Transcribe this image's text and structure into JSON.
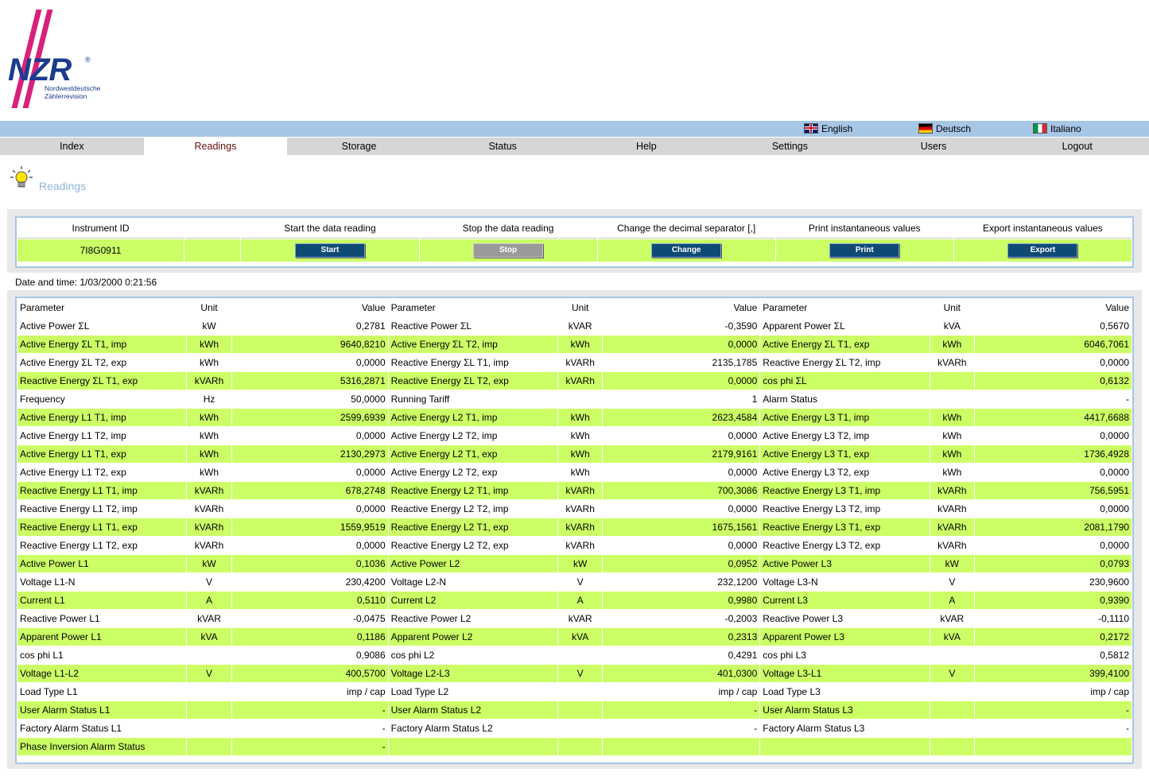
{
  "logo": {
    "brand": "NZR",
    "registered": "®",
    "subtitle_line1": "Nordwestdeutsche",
    "subtitle_line2": "Zählerrevision"
  },
  "languages": [
    {
      "label": "English",
      "icon": "flag-uk-icon"
    },
    {
      "label": "Deutsch",
      "icon": "flag-de-icon"
    },
    {
      "label": "Italiano",
      "icon": "flag-it-icon"
    }
  ],
  "nav": [
    {
      "label": "Index"
    },
    {
      "label": "Readings",
      "active": true
    },
    {
      "label": "Storage"
    },
    {
      "label": "Status"
    },
    {
      "label": "Help"
    },
    {
      "label": "Settings"
    },
    {
      "label": "Users"
    },
    {
      "label": "Logout"
    }
  ],
  "page": {
    "title": "Readings",
    "icon": "lightbulb-icon"
  },
  "controls": {
    "headers": [
      "Instrument ID",
      "",
      "Start the data reading",
      "Stop the data reading",
      "Change the decimal separator [,]",
      "Print instantaneous values",
      "Export instantaneous values"
    ],
    "instrument_id": "7I8G0911",
    "buttons": [
      {
        "label": "Start",
        "enabled": true
      },
      {
        "label": "Stop",
        "enabled": false
      },
      {
        "label": "Change",
        "enabled": true
      },
      {
        "label": "Print",
        "enabled": true
      },
      {
        "label": "Export",
        "enabled": true
      }
    ]
  },
  "datetime": "Date and time: 1/03/2000 0:21:56",
  "readings": {
    "headers": [
      "Parameter",
      "Unit",
      "Value"
    ],
    "rows": [
      [
        [
          "Active Power ΣL",
          "kW",
          "0,2781"
        ],
        [
          "Reactive Power ΣL",
          "kVAR",
          "-0,3590"
        ],
        [
          "Apparent Power ΣL",
          "kVA",
          "0,5670"
        ]
      ],
      [
        [
          "Active Energy ΣL T1, imp",
          "kWh",
          "9640,8210"
        ],
        [
          "Active Energy ΣL T2, imp",
          "kWh",
          "0,0000"
        ],
        [
          "Active Energy ΣL T1, exp",
          "kWh",
          "6046,7061"
        ]
      ],
      [
        [
          "Active Energy ΣL T2, exp",
          "kWh",
          "0,0000"
        ],
        [
          "Reactive Energy ΣL T1, imp",
          "kVARh",
          "2135,1785"
        ],
        [
          "Reactive Energy ΣL T2, imp",
          "kVARh",
          "0,0000"
        ]
      ],
      [
        [
          "Reactive Energy ΣL T1, exp",
          "kVARh",
          "5316,2871"
        ],
        [
          "Reactive Energy ΣL T2, exp",
          "kVARh",
          "0,0000"
        ],
        [
          "cos phi ΣL",
          "",
          "0,6132"
        ]
      ],
      [
        [
          "Frequency",
          "Hz",
          "50,0000"
        ],
        [
          "Running Tariff",
          "",
          "1"
        ],
        [
          "Alarm Status",
          "",
          "-"
        ]
      ],
      [
        [
          "Active Energy L1 T1, imp",
          "kWh",
          "2599,6939"
        ],
        [
          "Active Energy L2 T1, imp",
          "kWh",
          "2623,4584"
        ],
        [
          "Active Energy L3 T1, imp",
          "kWh",
          "4417,6688"
        ]
      ],
      [
        [
          "Active Energy L1 T2, imp",
          "kWh",
          "0,0000"
        ],
        [
          "Active Energy L2 T2, imp",
          "kWh",
          "0,0000"
        ],
        [
          "Active Energy L3 T2, imp",
          "kWh",
          "0,0000"
        ]
      ],
      [
        [
          "Active Energy L1 T1, exp",
          "kWh",
          "2130,2973"
        ],
        [
          "Active Energy L2 T1, exp",
          "kWh",
          "2179,9161"
        ],
        [
          "Active Energy L3 T1, exp",
          "kWh",
          "1736,4928"
        ]
      ],
      [
        [
          "Active Energy L1 T2, exp",
          "kWh",
          "0,0000"
        ],
        [
          "Active Energy L2 T2, exp",
          "kWh",
          "0,0000"
        ],
        [
          "Active Energy L3 T2, exp",
          "kWh",
          "0,0000"
        ]
      ],
      [
        [
          "Reactive Energy L1 T1, imp",
          "kVARh",
          "678,2748"
        ],
        [
          "Reactive Energy L2 T1, imp",
          "kVARh",
          "700,3086"
        ],
        [
          "Reactive Energy L3 T1, imp",
          "kVARh",
          "756,5951"
        ]
      ],
      [
        [
          "Reactive Energy L1 T2, imp",
          "kVARh",
          "0,0000"
        ],
        [
          "Reactive Energy L2 T2, imp",
          "kVARh",
          "0,0000"
        ],
        [
          "Reactive Energy L3 T2, imp",
          "kVARh",
          "0,0000"
        ]
      ],
      [
        [
          "Reactive Energy L1 T1, exp",
          "kVARh",
          "1559,9519"
        ],
        [
          "Reactive Energy L2 T1, exp",
          "kVARh",
          "1675,1561"
        ],
        [
          "Reactive Energy L3 T1, exp",
          "kVARh",
          "2081,1790"
        ]
      ],
      [
        [
          "Reactive Energy L1 T2, exp",
          "kVARh",
          "0,0000"
        ],
        [
          "Reactive Energy L2 T2, exp",
          "kVARh",
          "0,0000"
        ],
        [
          "Reactive Energy L3 T2, exp",
          "kVARh",
          "0,0000"
        ]
      ],
      [
        [
          "Active Power L1",
          "kW",
          "0,1036"
        ],
        [
          "Active Power L2",
          "kW",
          "0,0952"
        ],
        [
          "Active Power L3",
          "kW",
          "0,0793"
        ]
      ],
      [
        [
          "Voltage L1-N",
          "V",
          "230,4200"
        ],
        [
          "Voltage L2-N",
          "V",
          "232,1200"
        ],
        [
          "Voltage L3-N",
          "V",
          "230,9600"
        ]
      ],
      [
        [
          "Current L1",
          "A",
          "0,5110"
        ],
        [
          "Current L2",
          "A",
          "0,9980"
        ],
        [
          "Current L3",
          "A",
          "0,9390"
        ]
      ],
      [
        [
          "Reactive Power L1",
          "kVAR",
          "-0,0475"
        ],
        [
          "Reactive Power L2",
          "kVAR",
          "-0,2003"
        ],
        [
          "Reactive Power L3",
          "kVAR",
          "-0,1110"
        ]
      ],
      [
        [
          "Apparent Power L1",
          "kVA",
          "0,1186"
        ],
        [
          "Apparent Power L2",
          "kVA",
          "0,2313"
        ],
        [
          "Apparent Power L3",
          "kVA",
          "0,2172"
        ]
      ],
      [
        [
          "cos phi L1",
          "",
          "0,9086"
        ],
        [
          "cos phi L2",
          "",
          "0,4291"
        ],
        [
          "cos phi L3",
          "",
          "0,5812"
        ]
      ],
      [
        [
          "Voltage L1-L2",
          "V",
          "400,5700"
        ],
        [
          "Voltage L2-L3",
          "V",
          "401,0300"
        ],
        [
          "Voltage L3-L1",
          "V",
          "399,4100"
        ]
      ],
      [
        [
          "Load Type L1",
          "",
          "imp / cap"
        ],
        [
          "Load Type L2",
          "",
          "imp / cap"
        ],
        [
          "Load Type L3",
          "",
          "imp / cap"
        ]
      ],
      [
        [
          "User Alarm Status L1",
          "",
          "-"
        ],
        [
          "User Alarm Status L2",
          "",
          "-"
        ],
        [
          "User Alarm Status L3",
          "",
          "-"
        ]
      ],
      [
        [
          "Factory Alarm Status L1",
          "",
          "-"
        ],
        [
          "Factory Alarm Status L2",
          "",
          "-"
        ],
        [
          "Factory Alarm Status L3",
          "",
          "-"
        ]
      ],
      [
        [
          "Phase Inversion Alarm Status",
          "",
          "-"
        ],
        [
          "",
          "",
          ""
        ],
        [
          "",
          "",
          ""
        ]
      ]
    ]
  },
  "colors": {
    "row_highlight": "#ccff66",
    "language_bar": "#a7c7e7",
    "nav_bar": "#d6d6d6",
    "button": "#0f4a74",
    "brand_pink": "#d6227a",
    "brand_blue": "#1b3b8f"
  }
}
